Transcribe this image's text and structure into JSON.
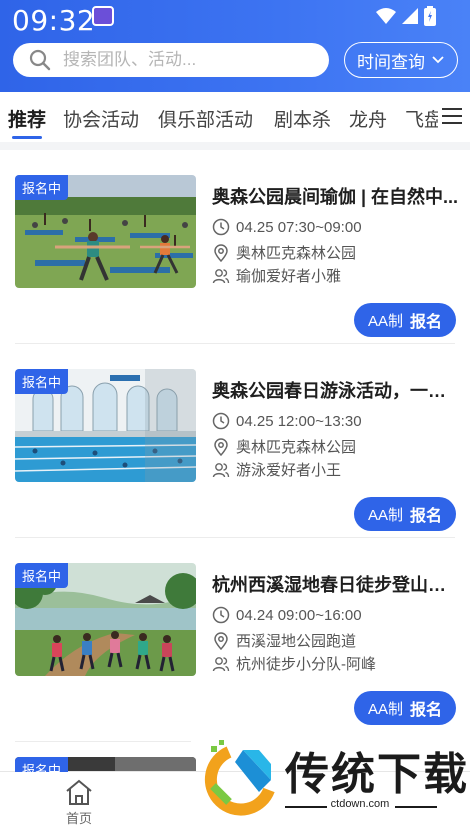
{
  "status_bar": {
    "time": "09:32"
  },
  "search": {
    "placeholder": "搜索团队、活动..."
  },
  "time_query": {
    "label": "时间查询"
  },
  "tabs": [
    {
      "label": "推荐",
      "active": true
    },
    {
      "label": "协会活动",
      "active": false
    },
    {
      "label": "俱乐部活动",
      "active": false
    },
    {
      "label": "剧本杀",
      "active": false
    },
    {
      "label": "龙舟",
      "active": false
    },
    {
      "label": "飞盘",
      "active": false
    }
  ],
  "activities": [
    {
      "badge": "报名中",
      "title": "奥森公园晨间瑜伽 | 在自然中...",
      "time": "04.25 07:30~09:00",
      "location": "奥林匹克森林公园",
      "organizer": "瑜伽爱好者小雅",
      "fee_type": "AA制",
      "action": "报名",
      "image": "yoga-group-in-park"
    },
    {
      "badge": "报名中",
      "title": "奥森公园春日游泳活动，一起...",
      "time": "04.25 12:00~13:30",
      "location": "奥林匹克森林公园",
      "organizer": "游泳爱好者小王",
      "fee_type": "AA制",
      "action": "报名",
      "image": "indoor-swimming-pool"
    },
    {
      "badge": "报名中",
      "title": "杭州西溪湿地春日徒步登山活...",
      "time": "04.24 09:00~16:00",
      "location": "西溪湿地公园跑道",
      "organizer": "杭州徒步小分队-阿峰",
      "fee_type": "AA制",
      "action": "报名",
      "image": "wetland-hiking-group"
    },
    {
      "badge": "报名中",
      "image": "dark-interior"
    }
  ],
  "bottom_nav": {
    "home_label": "首页"
  },
  "watermark": {
    "title": "传统下载",
    "url": "ctdown.com"
  },
  "colors": {
    "primary": "#2f64e8",
    "badge": "#2f64e8"
  }
}
